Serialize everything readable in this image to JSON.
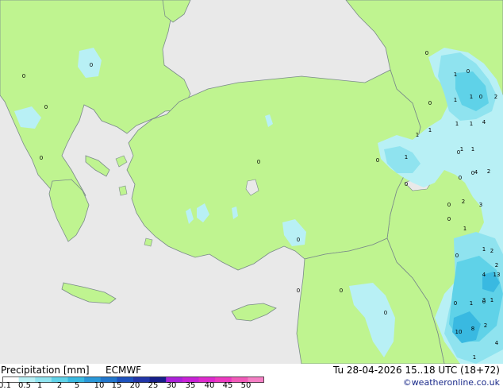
{
  "legend": {
    "title": "Precipitation [mm]",
    "model": "ECMWF",
    "colors": [
      "#ffffff",
      "#b8f0f5",
      "#8fe3ef",
      "#5fd2e8",
      "#39b9e1",
      "#2a98d8",
      "#2176cc",
      "#1d52be",
      "#2236a8",
      "#161f8a",
      "#ab22d9",
      "#c822d6",
      "#de2acd",
      "#ec39c0",
      "#f05ab8",
      "#f47fc4"
    ],
    "ticks": [
      "0.1",
      "0.5",
      "1",
      "2",
      "5",
      "10",
      "15",
      "20",
      "25",
      "30",
      "35",
      "40",
      "45",
      "50"
    ]
  },
  "valid_time": "Tu 28-04-2026 15..18 UTC (18+72)",
  "credit": "©weatheronline.co.uk",
  "map": {
    "colors": {
      "sea": "#e9e9e9",
      "land": "#bff490",
      "border": "#7a8a8a"
    },
    "labels": [
      "0",
      "0",
      "0",
      "0",
      "0",
      "0",
      "1",
      "0",
      "1",
      "1",
      "0",
      "2",
      "0",
      "0",
      "1",
      "1",
      "4",
      "1",
      "1",
      "0",
      "1",
      "1",
      "0",
      "1",
      "0",
      "0",
      "0",
      "4",
      "2",
      "0",
      "2",
      "3",
      "0",
      "1",
      "2",
      "1",
      "0",
      "2",
      "0",
      "0",
      "4",
      "13",
      "0",
      "1",
      "0",
      "0",
      "3",
      "1",
      "10",
      "8",
      "2",
      "4",
      "1"
    ]
  }
}
